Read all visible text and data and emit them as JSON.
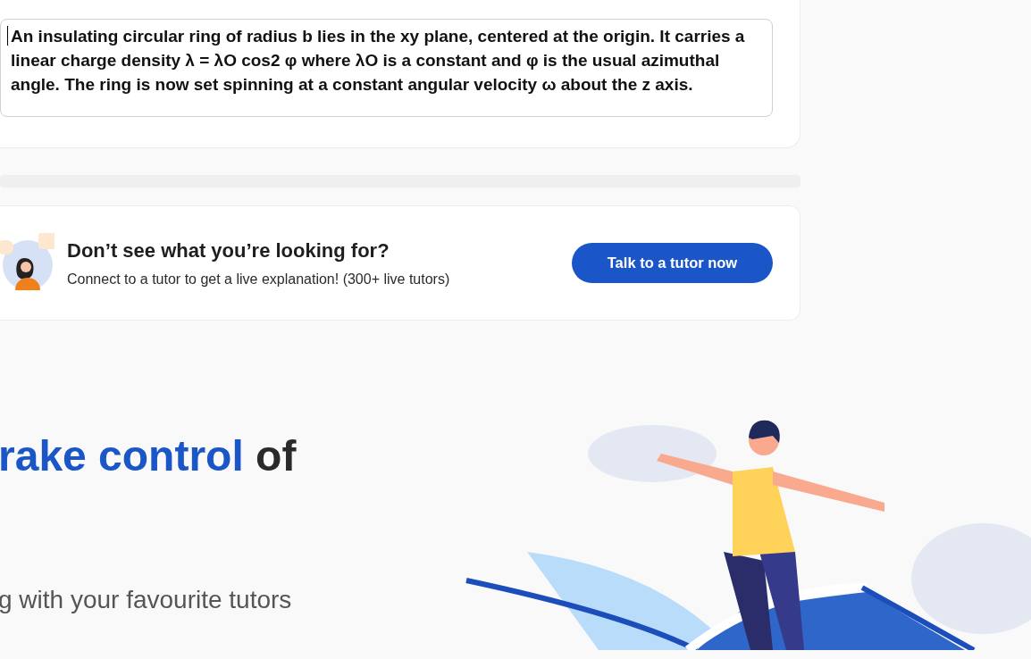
{
  "question_card": {
    "question_text": "An insulating circular ring of radius b lies in the xy plane, centered at the origin. It  carries a linear charge density λ = λO cos2 φ where λO is a constant and φ is the usual  azimuthal angle. The ring is now set spinning at a constant angular velocity ω about  the z axis."
  },
  "tutor_banner": {
    "title": "Don’t see what you’re looking for?",
    "subtitle": "Connect to a tutor to get a live explanation! (300+ live tutors)",
    "button": "Talk to a tutor now"
  },
  "hero": {
    "heading_highlight": "rake control",
    "heading_rest": "of",
    "subheading": "g with your favourite tutors"
  }
}
